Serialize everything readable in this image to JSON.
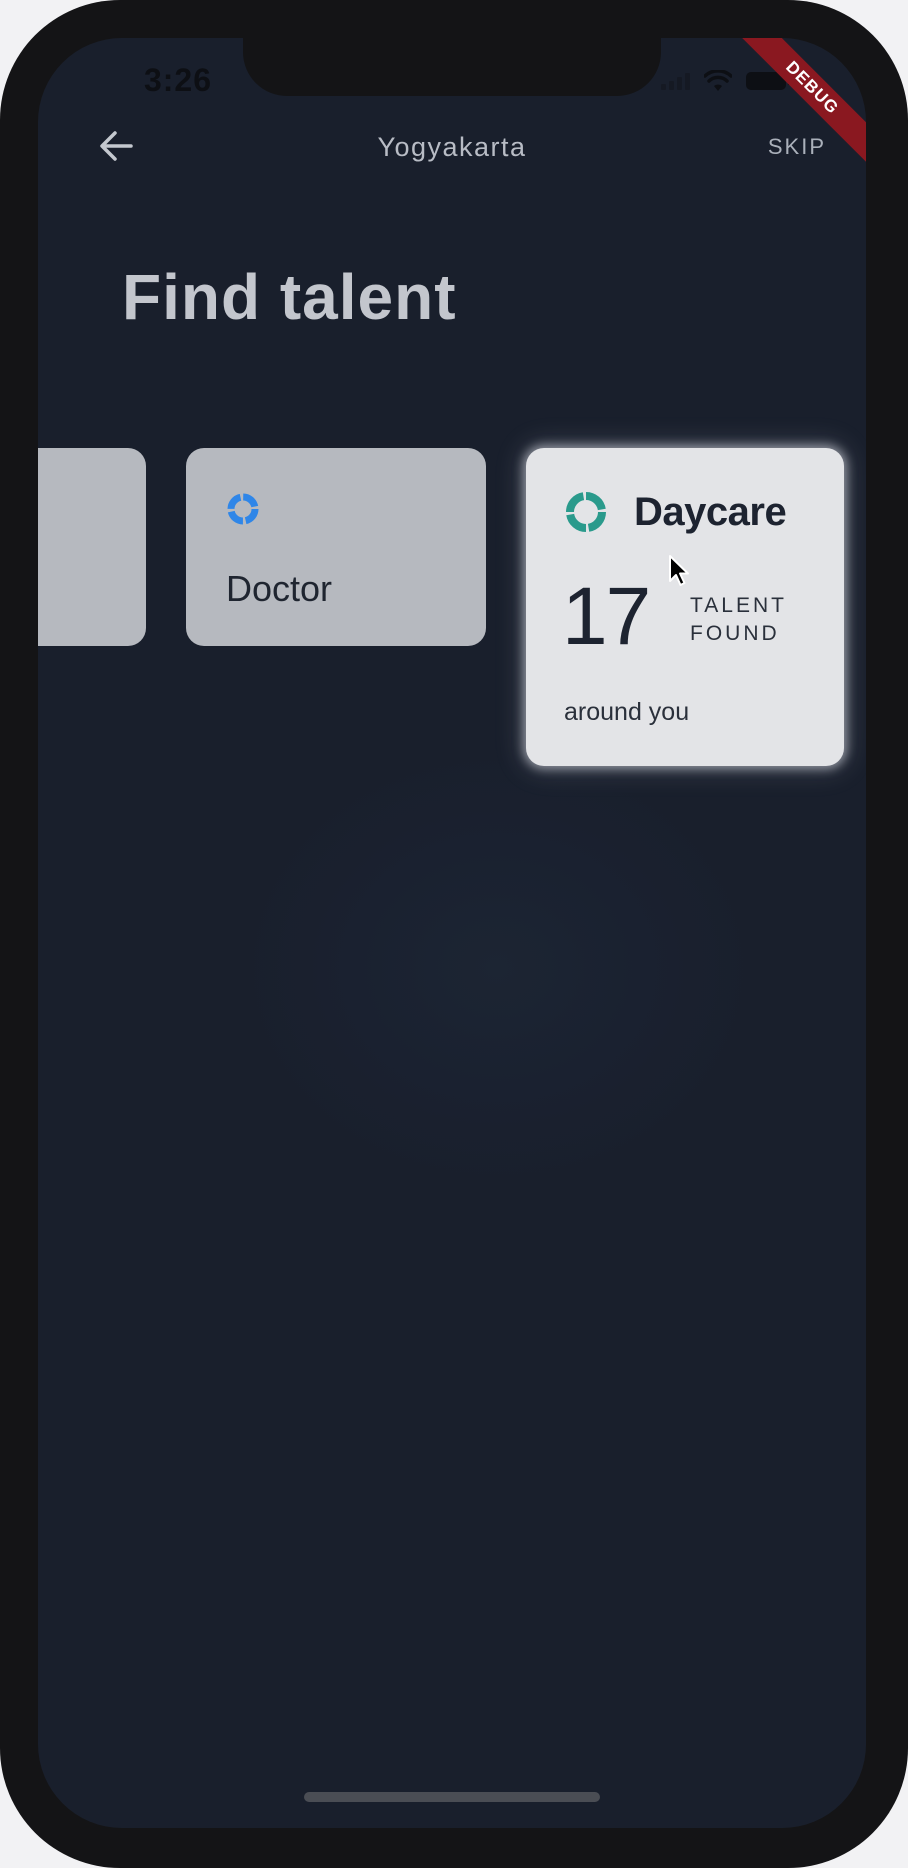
{
  "status_bar": {
    "time": "3:26",
    "debug_label": "DEBUG",
    "icons": [
      "signal-icon",
      "wifi-icon",
      "battery-icon"
    ]
  },
  "nav": {
    "back_icon": "arrow-left-icon",
    "title": "Yogyakarta",
    "skip_label": "SKIP"
  },
  "page": {
    "title": "Find talent"
  },
  "categories": [
    {
      "label": "Doctor",
      "icon": "ring-icon",
      "icon_color": "#2f86e8"
    },
    {
      "label": "Daycare",
      "icon": "ring-icon",
      "icon_color": "#2a9a8c",
      "count": "17",
      "count_unit_line1": "TALENT",
      "count_unit_line2": "FOUND",
      "subtitle": "around you",
      "selected": true
    }
  ],
  "colors": {
    "background": "#1a2130",
    "card": "#b6b9bf",
    "card_selected": "#e3e4e7",
    "accent_doctor": "#2f86e8",
    "accent_daycare": "#2a9a8c"
  }
}
